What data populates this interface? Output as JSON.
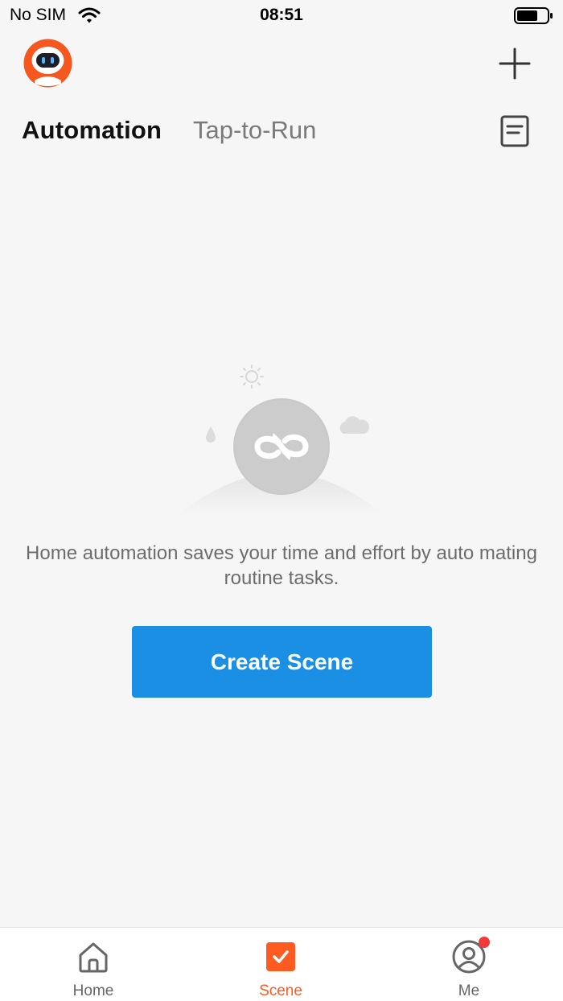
{
  "status_bar": {
    "carrier": "No SIM",
    "time": "08:51",
    "wifi_icon": "wifi-icon",
    "battery_icon": "battery-icon"
  },
  "header": {
    "avatar_icon": "robot-avatar-icon",
    "add_icon": "plus-icon"
  },
  "tabs": {
    "items": [
      {
        "label": "Automation",
        "active": true
      },
      {
        "label": "Tap-to-Run",
        "active": false
      }
    ],
    "log_icon": "document-log-icon"
  },
  "empty_state": {
    "illustration_icon": "automation-loop-icon",
    "message": "Home automation saves your time and effort by auto mating routine tasks.",
    "button_label": "Create Scene"
  },
  "bottom_nav": {
    "items": [
      {
        "label": "Home",
        "icon": "home-icon",
        "active": false
      },
      {
        "label": "Scene",
        "icon": "scene-check-icon",
        "active": true
      },
      {
        "label": "Me",
        "icon": "profile-icon",
        "active": false,
        "has_badge": true
      }
    ]
  },
  "colors": {
    "accent_blue": "#1a8fe3",
    "accent_orange": "#ff5a1f",
    "background": "#f6f6f6",
    "badge_red": "#f23a3a"
  }
}
